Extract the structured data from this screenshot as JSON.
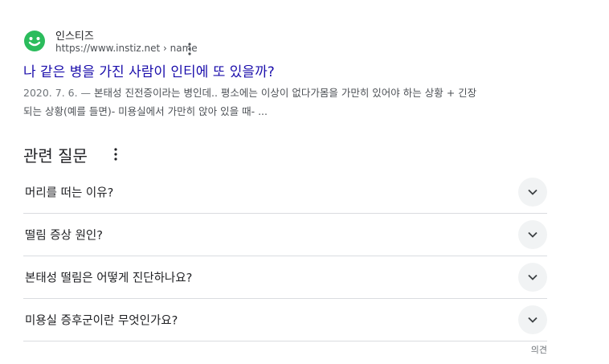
{
  "result": {
    "site_name": "인스티즈",
    "url": "https://www.instiz.net › name",
    "title": "나 같은 병을 가진 사람이 인티에 또 있을까?",
    "snippet_date": "2020. 7. 6. — ",
    "snippet_line1": "본태성 진전증이라는 병인데.. 평소에는 이상이 없다가몸을 가만히 있어야 하는 상황 + 긴장",
    "snippet_line2": "되는 상황(예를 들면)- 미용실에서 가만히 앉아 있을 때- ...",
    "favicon_color": "#2bbc5c"
  },
  "related_questions": {
    "title": "관련 질문",
    "items": [
      {
        "question": "머리를 떠는 이유?"
      },
      {
        "question": "떨림 증상 원인?"
      },
      {
        "question": "본태성 떨림은 어떻게 진단하나요?"
      },
      {
        "question": "미용실 증후군이란 무엇인가요?"
      }
    ],
    "feedback_label": "의견"
  },
  "icons": {
    "favicon": "smiley-face-icon",
    "menu": "more-vert-icon",
    "expand": "chevron-down-icon"
  },
  "colors": {
    "link": "#1a0dab",
    "text": "#202124",
    "muted": "#4d5156",
    "chevron_bg": "#f1f3f4"
  }
}
